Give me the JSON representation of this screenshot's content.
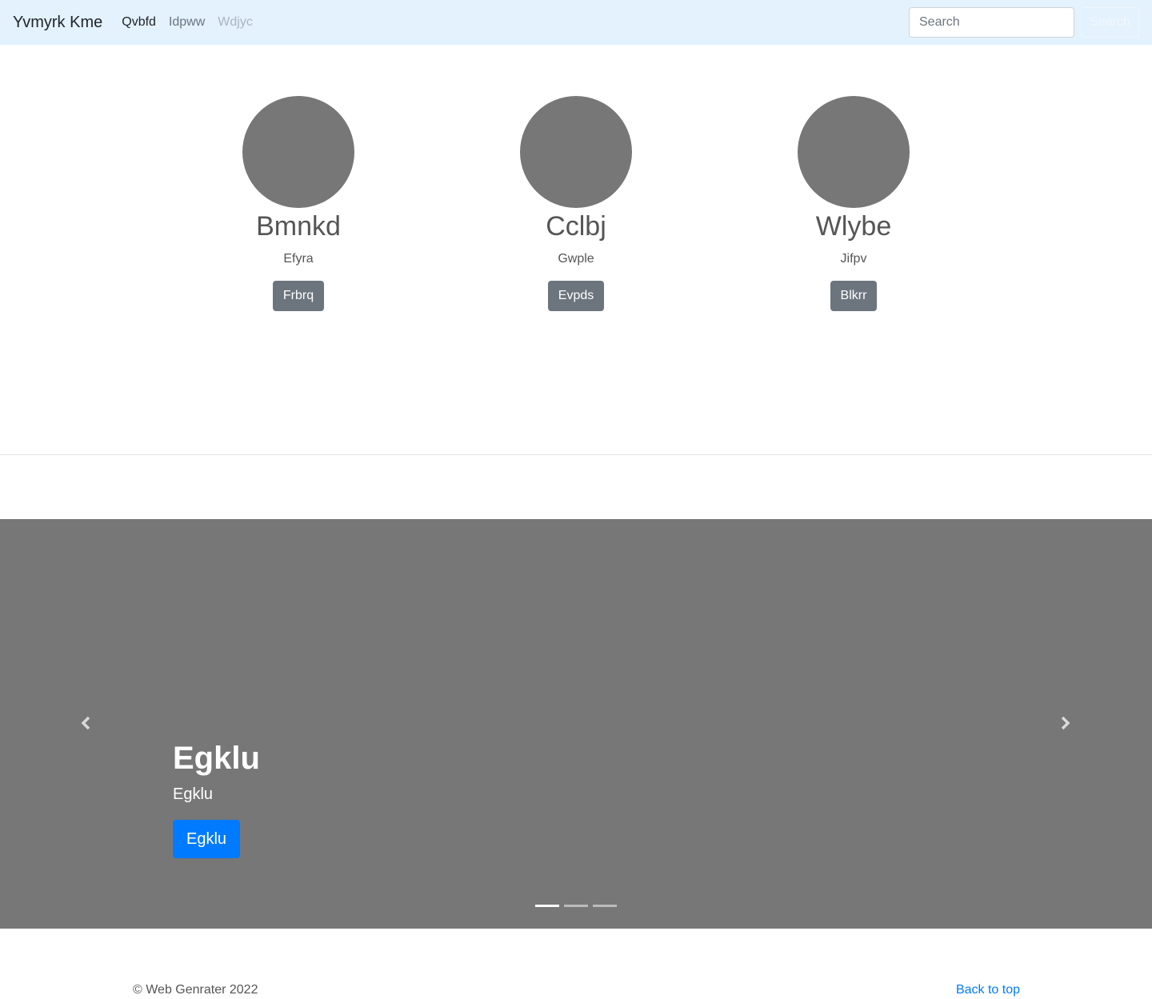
{
  "navbar": {
    "brand": "Yvmyrk Kme",
    "links": [
      {
        "label": "Qvbfd",
        "state": "active"
      },
      {
        "label": "Idpww",
        "state": "normal"
      },
      {
        "label": "Wdjyc",
        "state": "disabled"
      }
    ],
    "search_placeholder": "Search",
    "search_button": "Search",
    "background_color": "#e3f2fd"
  },
  "profiles": [
    {
      "name": "Bmnkd",
      "subtitle": "Efyra",
      "button": "Frbrq"
    },
    {
      "name": "Cclbj",
      "subtitle": "Gwple",
      "button": "Evpds"
    },
    {
      "name": "Wlybe",
      "subtitle": "Jifpv",
      "button": "Blkrr"
    }
  ],
  "carousel": {
    "background_color": "#777777",
    "caption_title": "Egklu",
    "caption_text": "Egklu",
    "caption_button": "Egklu",
    "slides_count": 3,
    "active_slide": 1,
    "prev_icon": "chevron-left-icon",
    "next_icon": "chevron-right-icon"
  },
  "footer": {
    "copyright": "© Web Genrater 2022",
    "back_to_top": "Back to top"
  }
}
